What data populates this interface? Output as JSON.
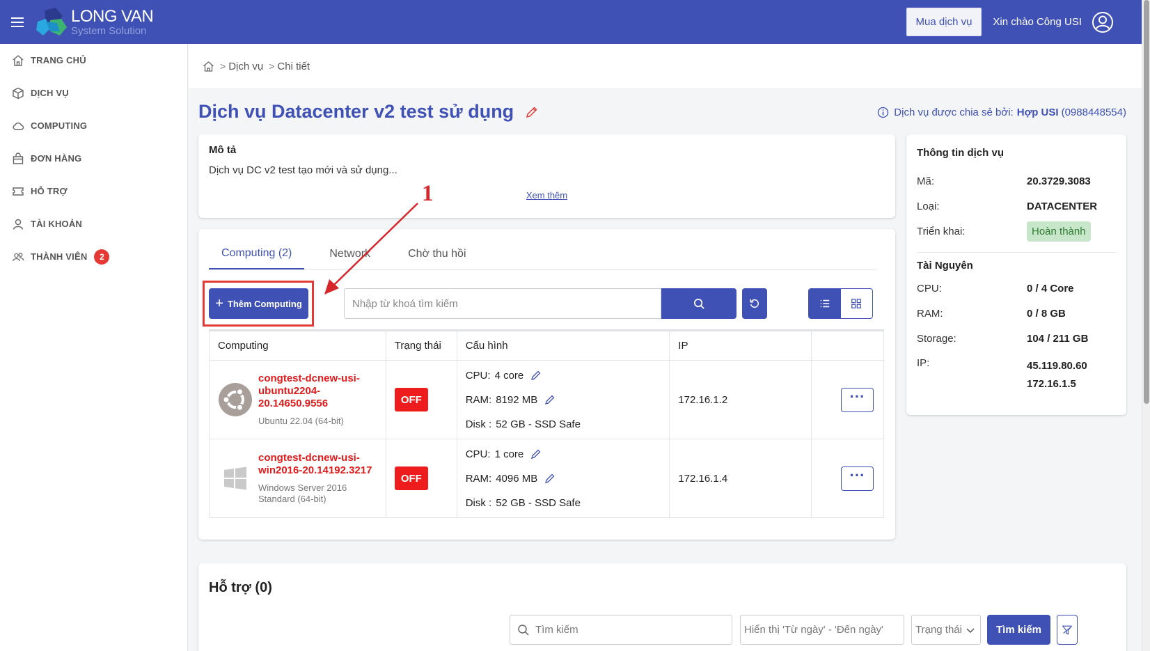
{
  "header": {
    "logo_line1": "LONG VAN",
    "logo_line2": "System Solution",
    "buy_label": "Mua dịch vụ",
    "greeting": "Xin chào Công USI"
  },
  "sidebar": {
    "items": [
      {
        "label": "TRANG CHỦ",
        "icon": "home-icon"
      },
      {
        "label": "DỊCH VỤ",
        "icon": "box-icon"
      },
      {
        "label": "COMPUTING",
        "icon": "cloud-icon"
      },
      {
        "label": "ĐƠN HÀNG",
        "icon": "bag-icon"
      },
      {
        "label": "HỖ TRỢ",
        "icon": "ticket-icon"
      },
      {
        "label": "TÀI KHOẢN",
        "icon": "user-icon"
      },
      {
        "label": "THÀNH VIÊN",
        "icon": "users-icon",
        "badge": "2"
      }
    ]
  },
  "breadcrumb": {
    "items": [
      "Dịch vụ",
      "Chi tiết"
    ]
  },
  "page": {
    "title": "Dịch vụ Datacenter v2 test sử dụng",
    "shared_prefix": "Dịch vụ được chia sẻ bởi:",
    "shared_by": "Hợp USI",
    "shared_phone": "(0988448554)"
  },
  "description": {
    "heading": "Mô tả",
    "text": "Dịch vụ DC v2 test tạo mới và sử dụng...",
    "more": "Xem thêm"
  },
  "computing": {
    "tabs": [
      "Computing (2)",
      "Network",
      "Chờ thu hồi"
    ],
    "add_label": "Thêm Computing",
    "search_placeholder": "Nhập từ khoá tìm kiếm",
    "columns": [
      "Computing",
      "Trạng thái",
      "Cấu hình",
      "IP"
    ],
    "rows": [
      {
        "name": "congtest-dcnew-usi-ubuntu2204-20.14650.9556",
        "os": "Ubuntu 22.04 (64-bit)",
        "status": "OFF",
        "cpu_label": "CPU:",
        "cpu": "4 core",
        "ram_label": "RAM:",
        "ram": "8192 MB",
        "disk_label": "Disk :",
        "disk": "52 GB - SSD Safe",
        "ip": "172.16.1.2"
      },
      {
        "name": "congtest-dcnew-usi-win2016-20.14192.3217",
        "os": "Windows Server 2016 Standard (64-bit)",
        "status": "OFF",
        "cpu_label": "CPU:",
        "cpu": "1 core",
        "ram_label": "RAM:",
        "ram": "4096 MB",
        "disk_label": "Disk :",
        "disk": "52 GB - SSD Safe",
        "ip": "172.16.1.4"
      }
    ],
    "more_glyph": "···"
  },
  "info": {
    "heading": "Thông tin dịch vụ",
    "ma_label": "Mã:",
    "ma": "20.3729.3083",
    "loai_label": "Loại:",
    "loai": "DATACENTER",
    "trienkhai_label": "Triển khai:",
    "trienkhai": "Hoàn thành",
    "resource_heading": "Tài Nguyên",
    "cpu_label": "CPU:",
    "cpu": "0 / 4 Core",
    "ram_label": "RAM:",
    "ram": "0 / 8 GB",
    "storage_label": "Storage:",
    "storage": "104 / 211 GB",
    "ip_label": "IP:",
    "ip1": "45.119.80.60",
    "ip2": "172.16.1.5"
  },
  "support": {
    "heading": "Hỗ trợ (0)",
    "search_placeholder": "Tìm kiếm",
    "date_placeholder": "Hiển thị 'Từ ngày' - 'Đến ngày'",
    "status_placeholder": "Trạng thái",
    "search_btn": "Tìm kiếm"
  },
  "annotation": {
    "number": "1",
    "color": "#d7262b"
  },
  "colors": {
    "primary": "#3f51b5",
    "danger": "#ee1c1c",
    "success_bg": "#c8e6c9"
  }
}
